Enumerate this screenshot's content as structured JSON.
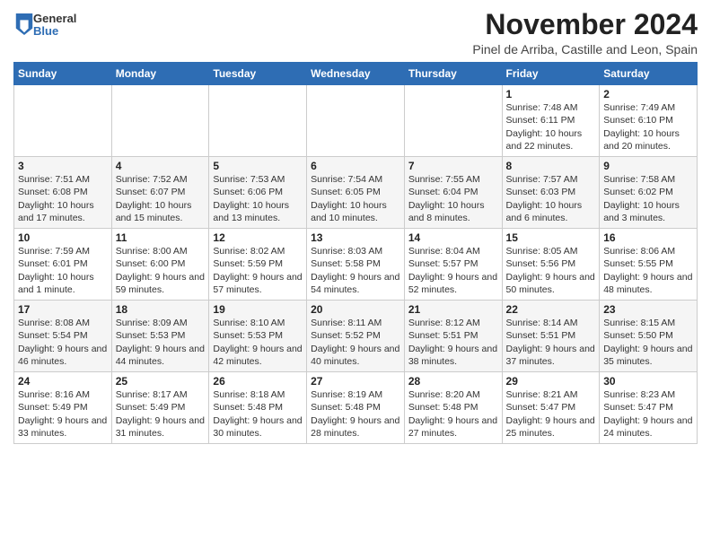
{
  "header": {
    "logo_general": "General",
    "logo_blue": "Blue",
    "month_title": "November 2024",
    "location": "Pinel de Arriba, Castille and Leon, Spain"
  },
  "days_of_week": [
    "Sunday",
    "Monday",
    "Tuesday",
    "Wednesday",
    "Thursday",
    "Friday",
    "Saturday"
  ],
  "weeks": [
    [
      {
        "day": "",
        "info": ""
      },
      {
        "day": "",
        "info": ""
      },
      {
        "day": "",
        "info": ""
      },
      {
        "day": "",
        "info": ""
      },
      {
        "day": "",
        "info": ""
      },
      {
        "day": "1",
        "info": "Sunrise: 7:48 AM\nSunset: 6:11 PM\nDaylight: 10 hours and 22 minutes."
      },
      {
        "day": "2",
        "info": "Sunrise: 7:49 AM\nSunset: 6:10 PM\nDaylight: 10 hours and 20 minutes."
      }
    ],
    [
      {
        "day": "3",
        "info": "Sunrise: 7:51 AM\nSunset: 6:08 PM\nDaylight: 10 hours and 17 minutes."
      },
      {
        "day": "4",
        "info": "Sunrise: 7:52 AM\nSunset: 6:07 PM\nDaylight: 10 hours and 15 minutes."
      },
      {
        "day": "5",
        "info": "Sunrise: 7:53 AM\nSunset: 6:06 PM\nDaylight: 10 hours and 13 minutes."
      },
      {
        "day": "6",
        "info": "Sunrise: 7:54 AM\nSunset: 6:05 PM\nDaylight: 10 hours and 10 minutes."
      },
      {
        "day": "7",
        "info": "Sunrise: 7:55 AM\nSunset: 6:04 PM\nDaylight: 10 hours and 8 minutes."
      },
      {
        "day": "8",
        "info": "Sunrise: 7:57 AM\nSunset: 6:03 PM\nDaylight: 10 hours and 6 minutes."
      },
      {
        "day": "9",
        "info": "Sunrise: 7:58 AM\nSunset: 6:02 PM\nDaylight: 10 hours and 3 minutes."
      }
    ],
    [
      {
        "day": "10",
        "info": "Sunrise: 7:59 AM\nSunset: 6:01 PM\nDaylight: 10 hours and 1 minute."
      },
      {
        "day": "11",
        "info": "Sunrise: 8:00 AM\nSunset: 6:00 PM\nDaylight: 9 hours and 59 minutes."
      },
      {
        "day": "12",
        "info": "Sunrise: 8:02 AM\nSunset: 5:59 PM\nDaylight: 9 hours and 57 minutes."
      },
      {
        "day": "13",
        "info": "Sunrise: 8:03 AM\nSunset: 5:58 PM\nDaylight: 9 hours and 54 minutes."
      },
      {
        "day": "14",
        "info": "Sunrise: 8:04 AM\nSunset: 5:57 PM\nDaylight: 9 hours and 52 minutes."
      },
      {
        "day": "15",
        "info": "Sunrise: 8:05 AM\nSunset: 5:56 PM\nDaylight: 9 hours and 50 minutes."
      },
      {
        "day": "16",
        "info": "Sunrise: 8:06 AM\nSunset: 5:55 PM\nDaylight: 9 hours and 48 minutes."
      }
    ],
    [
      {
        "day": "17",
        "info": "Sunrise: 8:08 AM\nSunset: 5:54 PM\nDaylight: 9 hours and 46 minutes."
      },
      {
        "day": "18",
        "info": "Sunrise: 8:09 AM\nSunset: 5:53 PM\nDaylight: 9 hours and 44 minutes."
      },
      {
        "day": "19",
        "info": "Sunrise: 8:10 AM\nSunset: 5:53 PM\nDaylight: 9 hours and 42 minutes."
      },
      {
        "day": "20",
        "info": "Sunrise: 8:11 AM\nSunset: 5:52 PM\nDaylight: 9 hours and 40 minutes."
      },
      {
        "day": "21",
        "info": "Sunrise: 8:12 AM\nSunset: 5:51 PM\nDaylight: 9 hours and 38 minutes."
      },
      {
        "day": "22",
        "info": "Sunrise: 8:14 AM\nSunset: 5:51 PM\nDaylight: 9 hours and 37 minutes."
      },
      {
        "day": "23",
        "info": "Sunrise: 8:15 AM\nSunset: 5:50 PM\nDaylight: 9 hours and 35 minutes."
      }
    ],
    [
      {
        "day": "24",
        "info": "Sunrise: 8:16 AM\nSunset: 5:49 PM\nDaylight: 9 hours and 33 minutes."
      },
      {
        "day": "25",
        "info": "Sunrise: 8:17 AM\nSunset: 5:49 PM\nDaylight: 9 hours and 31 minutes."
      },
      {
        "day": "26",
        "info": "Sunrise: 8:18 AM\nSunset: 5:48 PM\nDaylight: 9 hours and 30 minutes."
      },
      {
        "day": "27",
        "info": "Sunrise: 8:19 AM\nSunset: 5:48 PM\nDaylight: 9 hours and 28 minutes."
      },
      {
        "day": "28",
        "info": "Sunrise: 8:20 AM\nSunset: 5:48 PM\nDaylight: 9 hours and 27 minutes."
      },
      {
        "day": "29",
        "info": "Sunrise: 8:21 AM\nSunset: 5:47 PM\nDaylight: 9 hours and 25 minutes."
      },
      {
        "day": "30",
        "info": "Sunrise: 8:23 AM\nSunset: 5:47 PM\nDaylight: 9 hours and 24 minutes."
      }
    ]
  ]
}
